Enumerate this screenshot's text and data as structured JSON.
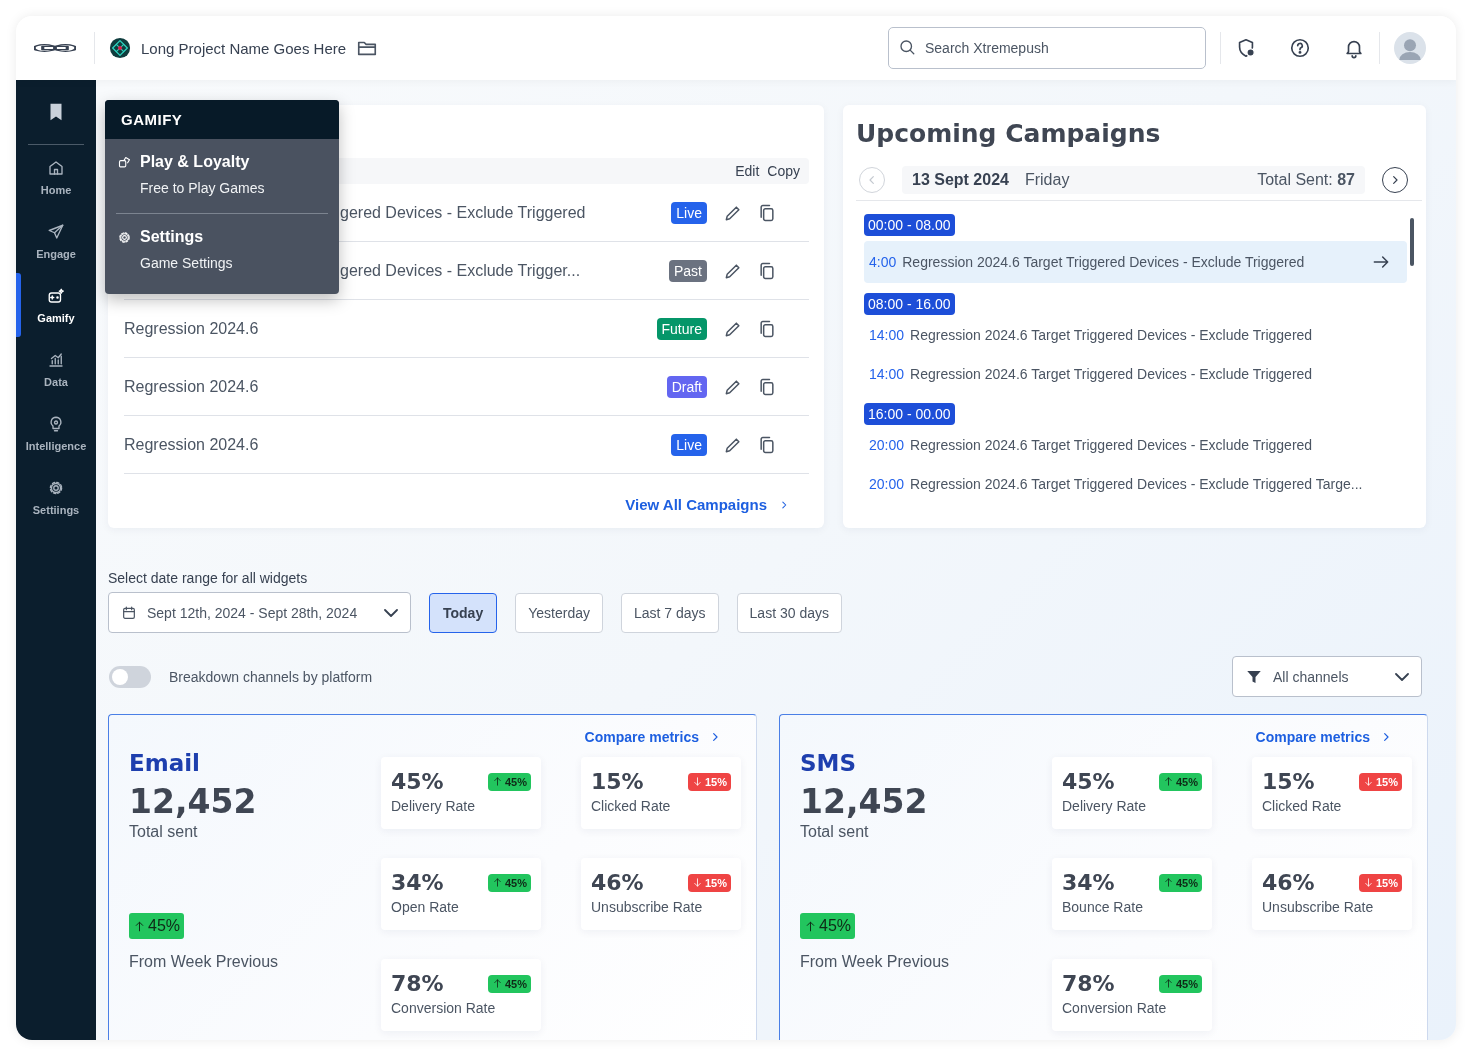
{
  "header": {
    "project_name": "Long Project Name Goes Here",
    "search": {
      "placeholder": "Search Xtremepush"
    }
  },
  "sidebar": {
    "items": [
      {
        "label": "Home",
        "selected": false
      },
      {
        "label": "Engage",
        "selected": false
      },
      {
        "label": "Gamify",
        "selected": true
      },
      {
        "label": "Data",
        "selected": false
      },
      {
        "label": "Intelligence",
        "selected": false
      },
      {
        "label": "Settiings",
        "selected": false
      }
    ]
  },
  "menu": {
    "title": "GAMIFY",
    "sections": [
      {
        "label": "Play & Loyalty",
        "items": [
          "Free to Play Games"
        ]
      },
      {
        "label": "Settings",
        "items": [
          "Game Settings"
        ]
      }
    ]
  },
  "campaigns": {
    "columns": [
      "Edit",
      "Copy"
    ],
    "rows": [
      {
        "name": "gered Devices - Exclude Triggered",
        "status": "Live",
        "color": "#2563eb"
      },
      {
        "name": "gered Devices - Exclude Trigger...",
        "status": "Past",
        "color": "#6b7280"
      },
      {
        "name": "Regression 2024.6",
        "status": "Future",
        "color": "#059669"
      },
      {
        "name": "Regression 2024.6",
        "status": "Draft",
        "color": "#6366f1"
      },
      {
        "name": "Regression 2024.6",
        "status": "Live",
        "color": "#2563eb"
      }
    ],
    "link": "View All Campaigns"
  },
  "upcoming": {
    "title": "Upcoming Campaigns",
    "date": "13 Sept 2024",
    "day": "Friday",
    "total_label": "Total Sent:",
    "total": "87",
    "groups": [
      {
        "range": "00:00 - 08.00",
        "entries": [
          {
            "time": "4:00",
            "name": "Regression 2024.6 Target Triggered Devices - Exclude Triggered",
            "selected": true
          }
        ]
      },
      {
        "range": "08:00 - 16.00",
        "entries": [
          {
            "time": "14:00",
            "name": "Regression 2024.6 Target Triggered Devices - Exclude Triggered",
            "selected": false
          },
          {
            "time": "14:00",
            "name": "Regression 2024.6 Target Triggered Devices - Exclude Triggered",
            "selected": false
          }
        ]
      },
      {
        "range": "16:00 - 00.00",
        "entries": [
          {
            "time": "20:00",
            "name": "Regression 2024.6 Target Triggered Devices - Exclude Triggered",
            "selected": false
          },
          {
            "time": "20:00",
            "name": "Regression 2024.6 Target Triggered Devices - Exclude Triggered Targe...",
            "selected": false
          }
        ]
      }
    ]
  },
  "date_range": {
    "label": "Select date range for all widgets",
    "value": "Sept 12th, 2024 - Sept 28th, 2024",
    "presets": [
      {
        "label": "Today",
        "selected": true
      },
      {
        "label": "Yesterday",
        "selected": false
      },
      {
        "label": "Last 7 days",
        "selected": false
      },
      {
        "label": "Last 30 days",
        "selected": false
      }
    ]
  },
  "breakdown": {
    "label": "Breakdown channels by platform",
    "on": false
  },
  "channel_filter": {
    "value": "All channels"
  },
  "channels": [
    {
      "name": "Email",
      "total": "12,452",
      "total_label": "Total sent",
      "change": "45%",
      "kind": "up",
      "change_label": "From Week Previous",
      "compare_link": "Compare metrics",
      "metrics": [
        {
          "value": "45%",
          "label": "Delivery Rate",
          "change": "45%",
          "kind": "up"
        },
        {
          "value": "15%",
          "label": "Clicked Rate",
          "change": "15%",
          "kind": "down"
        },
        {
          "value": "34%",
          "label": "Open Rate",
          "change": "45%",
          "kind": "up"
        },
        {
          "value": "46%",
          "label": "Unsubscribe Rate",
          "change": "15%",
          "kind": "down"
        },
        {
          "value": "78%",
          "label": "Conversion Rate",
          "change": "45%",
          "kind": "up"
        }
      ]
    },
    {
      "name": "SMS",
      "total": "12,452",
      "total_label": "Total sent",
      "change": "45%",
      "kind": "up",
      "change_label": "From Week Previous",
      "compare_link": "Compare metrics",
      "metrics": [
        {
          "value": "45%",
          "label": "Delivery Rate",
          "change": "45%",
          "kind": "up"
        },
        {
          "value": "15%",
          "label": "Clicked Rate",
          "change": "15%",
          "kind": "down"
        },
        {
          "value": "34%",
          "label": "Bounce Rate",
          "change": "45%",
          "kind": "up"
        },
        {
          "value": "46%",
          "label": "Unsubscribe Rate",
          "change": "15%",
          "kind": "down"
        },
        {
          "value": "78%",
          "label": "Conversion Rate",
          "change": "45%",
          "kind": "up"
        }
      ]
    }
  ]
}
